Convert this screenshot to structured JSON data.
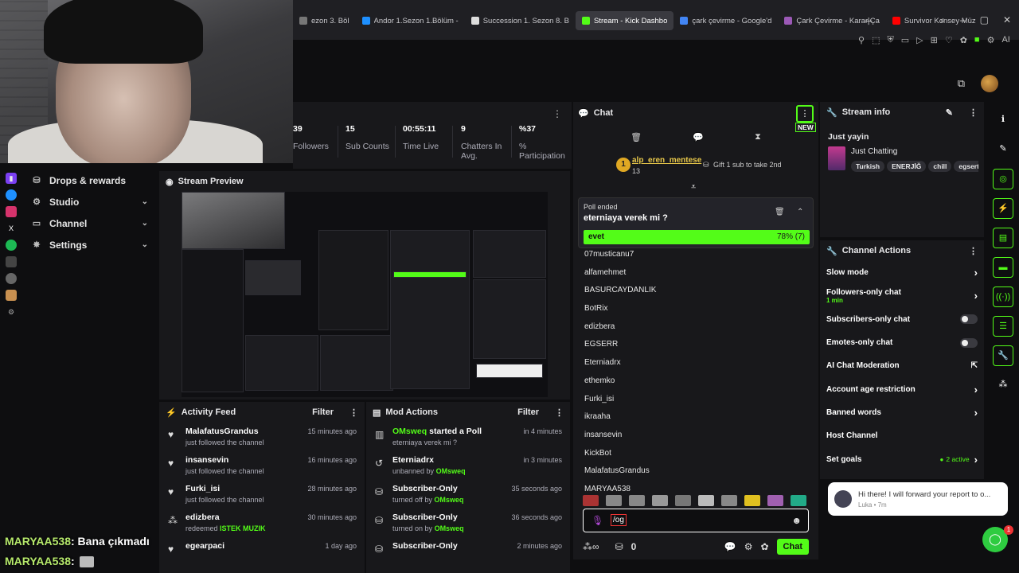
{
  "browser": {
    "tabs": [
      {
        "label": "ezon 3. Böl",
        "color": "#777",
        "active": false
      },
      {
        "label": "Andor 1.Sezon 1.Bölüm -",
        "color": "#1e90ff",
        "active": false
      },
      {
        "label": "Succession 1. Sezon 8. B",
        "color": "#ddd",
        "active": false
      },
      {
        "label": "Stream - Kick Dashbo",
        "color": "#53fc18",
        "active": true
      },
      {
        "label": "çark çevirme - Google'd",
        "color": "#4285f4",
        "active": false
      },
      {
        "label": "Çark Çevirme - Karar Ça",
        "color": "#9b59b6",
        "active": false
      },
      {
        "label": "Survivor Konsey Müz",
        "color": "#ff0000",
        "active": false
      }
    ]
  },
  "stats": [
    {
      "value": "39",
      "label": "Followers"
    },
    {
      "value": "15",
      "label": "Sub Counts"
    },
    {
      "value": "00:55:11",
      "label": "Time Live"
    },
    {
      "value": "9",
      "label": "Chatters In Avg."
    },
    {
      "value": "%37",
      "label": "% Participation"
    }
  ],
  "nav": [
    {
      "label": "Drops & rewards",
      "icon": "gift-icon",
      "chev": ""
    },
    {
      "label": "Studio",
      "icon": "studio-icon",
      "chev": "⌄"
    },
    {
      "label": "Channel",
      "icon": "channel-icon",
      "chev": "⌄"
    },
    {
      "label": "Settings",
      "icon": "gear-icon",
      "chev": "⌄"
    }
  ],
  "preview": {
    "title": "Stream Preview"
  },
  "activity": {
    "title": "Activity Feed",
    "filter": "Filter",
    "items": [
      {
        "name": "MalafatusGrandus",
        "sub": "just followed the channel",
        "highlight": "",
        "time": "15 minutes ago",
        "icon": "heart-icon"
      },
      {
        "name": "insansevin",
        "sub": "just followed the channel",
        "highlight": "",
        "time": "16 minutes ago",
        "icon": "heart-icon"
      },
      {
        "name": "Furki_isi",
        "sub": "just followed the channel",
        "highlight": "",
        "time": "28 minutes ago",
        "icon": "heart-icon"
      },
      {
        "name": "edizbera",
        "sub": "redeemed",
        "highlight": "ISTEK MUZIK",
        "time": "30 minutes ago",
        "icon": "redeem-icon"
      },
      {
        "name": "egearpaci",
        "sub": "",
        "highlight": "",
        "time": "1 day ago",
        "icon": "heart-icon"
      }
    ]
  },
  "mod": {
    "title": "Mod Actions",
    "filter": "Filter",
    "items": [
      {
        "name": "OMsweq",
        "action": "started a Poll",
        "sub": "eterniaya verek mi ?",
        "by": "",
        "time": "in 4 minutes",
        "icon": "poll-icon"
      },
      {
        "name": "Eterniadrx",
        "action": "",
        "sub": "unbanned by",
        "by": "OMsweq",
        "time": "in 3 minutes",
        "icon": "unban-icon"
      },
      {
        "name": "Subscriber-Only",
        "action": "",
        "sub": "turned off by",
        "by": "OMsweq",
        "time": "35 seconds ago",
        "icon": "gift-icon"
      },
      {
        "name": "Subscriber-Only",
        "action": "",
        "sub": "turned on by",
        "by": "OMsweq",
        "time": "36 seconds ago",
        "icon": "gift-icon"
      },
      {
        "name": "Subscriber-Only",
        "action": "",
        "sub": "",
        "by": "",
        "time": "2 minutes ago",
        "icon": "gift-icon"
      }
    ]
  },
  "chat": {
    "title": "Chat",
    "new_badge": "NEW",
    "pinned": {
      "user": "alp_eren_mentese",
      "count": "13",
      "rank": "1",
      "gift": "Gift 1 sub to take 2nd"
    },
    "poll": {
      "status": "Poll ended",
      "question": "eterniaya verek mi ?",
      "option": "evet",
      "result": "78% (7)",
      "fraction": 1.0
    },
    "users": [
      "07musticanu7",
      "alfamehmet",
      "BASURCAYDANLIK",
      "BotRix",
      "edizbera",
      "EGSERR",
      "Eterniadrx",
      "ethemko",
      "Furki_isi",
      "ikraaha",
      "insansevin",
      "KickBot",
      "MalafatusGrandus",
      "MARYAA538"
    ],
    "input_value": "/og",
    "points": "0",
    "send": "Chat"
  },
  "streaminfo": {
    "title": "Stream info",
    "stream_title": "Just yayin",
    "category": "Just Chatting",
    "tags": [
      "Turkish",
      "ENERJİĞ",
      "chill",
      "egsert"
    ]
  },
  "channelactions": {
    "title": "Channel Actions",
    "items": [
      {
        "label": "Slow mode",
        "sub": "",
        "ctrl": "chev"
      },
      {
        "label": "Followers-only chat",
        "sub": "1 min",
        "ctrl": "chev"
      },
      {
        "label": "Subscribers-only chat",
        "sub": "",
        "ctrl": "toggle"
      },
      {
        "label": "Emotes-only chat",
        "sub": "",
        "ctrl": "toggle"
      },
      {
        "label": "AI Chat Moderation",
        "sub": "",
        "ctrl": "ext"
      },
      {
        "label": "Account age restriction",
        "sub": "",
        "ctrl": "chev"
      },
      {
        "label": "Banned words",
        "sub": "",
        "ctrl": "chev"
      },
      {
        "label": "Host Channel",
        "sub": "",
        "ctrl": "none"
      },
      {
        "label": "Set goals",
        "sub": "",
        "ctrl": "goals",
        "extra": "2 active"
      }
    ]
  },
  "toast": {
    "message": "Hi there!  I will forward your report to o...",
    "meta": "Luka • 7m"
  },
  "help_badge": "1",
  "overlay": [
    {
      "user": "MARYAA538",
      "msg": ": Bana çıkmadı"
    },
    {
      "user": "MARYAA538",
      "msg": ": "
    }
  ]
}
